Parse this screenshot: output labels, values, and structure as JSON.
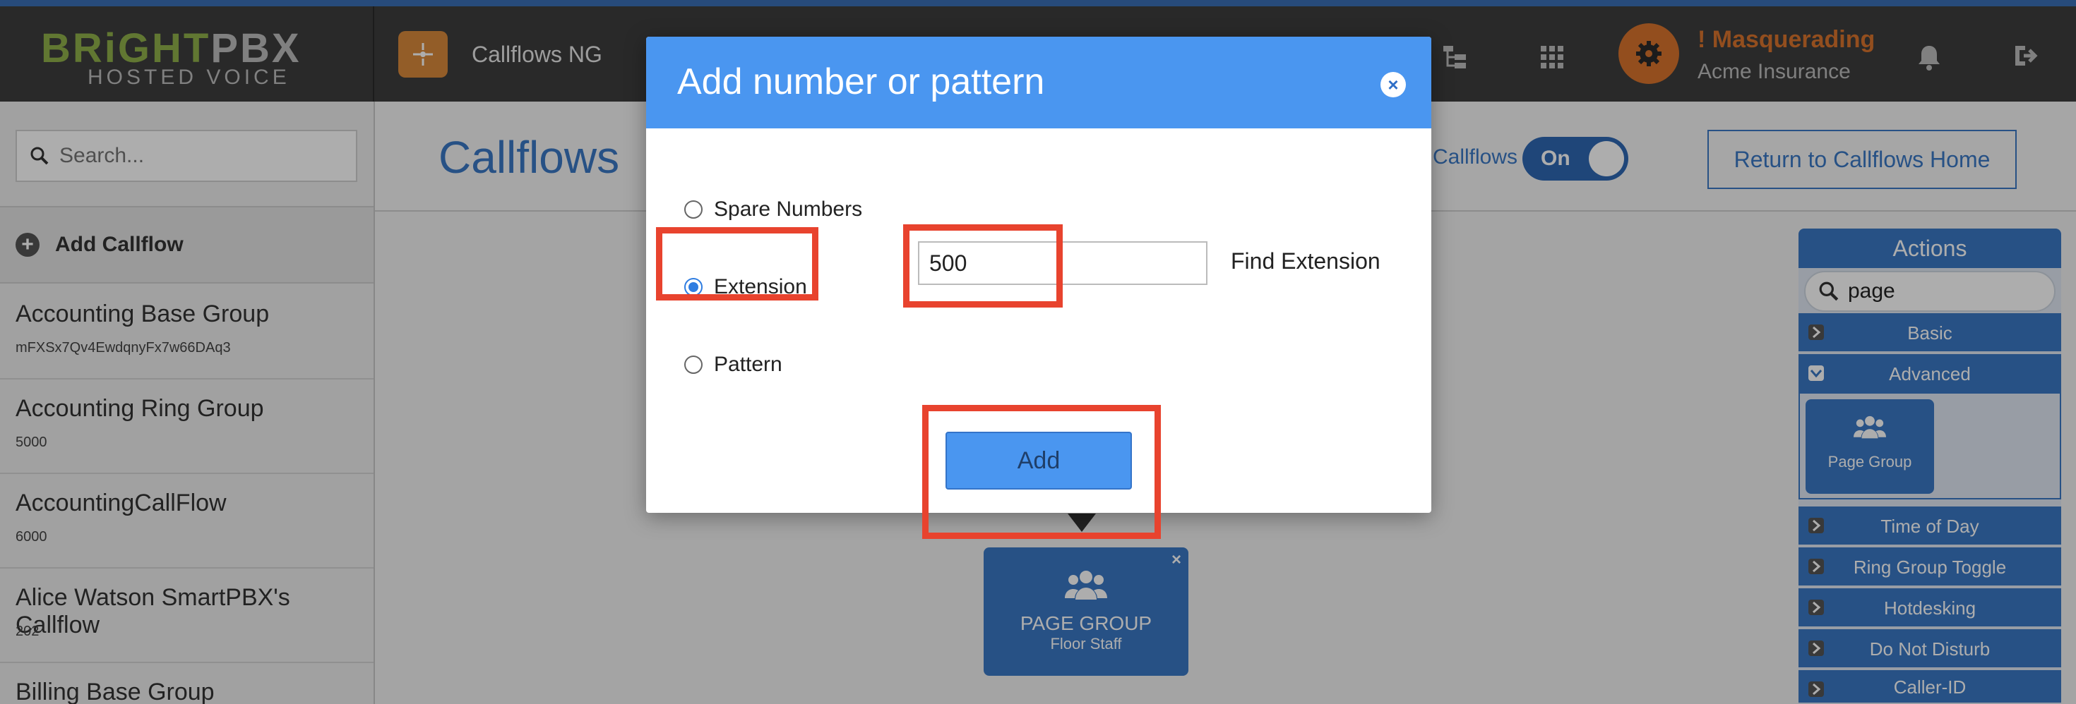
{
  "topbar": {
    "logo_part1": "BRiGHT",
    "logo_part2": "PBX",
    "logo_sub": "HOSTED VOICE",
    "app_title": "Callflows NG",
    "masquerade_label": "! Masquerading",
    "account_name": "Acme Insurance",
    "icons": [
      "sitemap-icon",
      "apps-grid-icon",
      "gear-icon",
      "bell-icon",
      "logout-icon"
    ]
  },
  "sidebar": {
    "search_placeholder": "Search...",
    "add_label": "Add Callflow",
    "items": [
      {
        "name": "Accounting Base Group",
        "sub": "mFXSx7Qv4EwdqnyFx7w66DAq3"
      },
      {
        "name": "Accounting Ring Group",
        "sub": "5000"
      },
      {
        "name": "AccountingCallFlow",
        "sub": "6000"
      },
      {
        "name": "Alice Watson SmartPBX's Callflow",
        "sub": "202"
      },
      {
        "name": "Billing Base Group",
        "sub": ""
      }
    ]
  },
  "main": {
    "title": "Callflows",
    "toggle_label": "Callflows",
    "toggle_state": "On",
    "return_button": "Return to Callflows Home",
    "node": {
      "title": "PAGE GROUP",
      "subtitle": "Floor Staff"
    }
  },
  "actions": {
    "title": "Actions",
    "search_value": "page",
    "rows": [
      "Basic",
      "Advanced",
      "Time of Day",
      "Ring Group Toggle",
      "Hotdesking",
      "Do Not Disturb",
      "Caller-ID"
    ],
    "tile_label": "Page Group"
  },
  "modal": {
    "title": "Add number or pattern",
    "options": [
      "Spare Numbers",
      "Extension",
      "Pattern"
    ],
    "selected_option": "Extension",
    "extension_value": "500",
    "find_label": "Find Extension",
    "add_button": "Add"
  },
  "colors": {
    "accent": "#3a78c4",
    "modal_header": "#4a96f0",
    "highlight": "#e8432e",
    "masquerade": "#d9742d"
  }
}
